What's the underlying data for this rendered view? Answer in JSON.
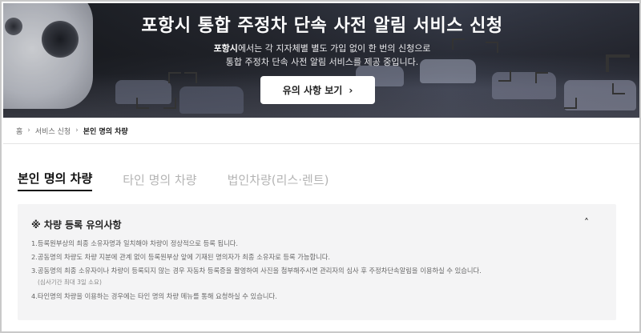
{
  "hero": {
    "title": "포항시 통합 주정차 단속 사전 알림 서비스 신청",
    "subtitle_bold": "포항시",
    "subtitle_line1_rest": "에서는 각 지자체별 별도 가입 없이 한 번의 신청으로",
    "subtitle_line2": "통합 주정차 단속 사전 알림 서비스를 제공 중입니다.",
    "button_label": "유의 사항 보기",
    "button_icon": "chevron-right-icon"
  },
  "breadcrumb": {
    "items": [
      "홈",
      "서비스 신청",
      "본인 명의 차량"
    ],
    "separator_icon": "chevron-right-icon"
  },
  "tabs": [
    {
      "label": "본인 명의 차량",
      "active": true
    },
    {
      "label": "타인 명의 차량",
      "active": false
    },
    {
      "label": "법인차량(리스·렌트)",
      "active": false
    }
  ],
  "notice": {
    "title": "※ 차량 등록 유의사항",
    "toggle_icon": "chevron-up-icon",
    "items": [
      {
        "text": "1.등록원부상의 최종 소유자명과 일치해야 차량이 정상적으로 등록 됩니다."
      },
      {
        "text": "2.공동명의 차량도 차량 지분에 관계 없이 등록원부상 앞에 기재된 명의자가 최종 소유자로 등록 가능합니다."
      },
      {
        "text": "3.공동명의 최종 소유자이나 차량이 등록되지 않는 경우 자동차 등록증을 촬영하여 사진을 첨부해주시면 관리자의 심사 후 주정차단속알림을 이용하실 수 있습니다.",
        "sub": "(심사기간 최대 3일 소요)"
      },
      {
        "text": "4.타인명의 차량을 이용하는 경우에는 타인 명의 차량 메뉴를 통해 요청하실 수 있습니다."
      }
    ]
  },
  "colors": {
    "accent_red": "#e23b3b",
    "accent_green": "#36c043",
    "tab_active": "#111111",
    "tab_inactive": "#b4b4b4",
    "notice_bg": "#f4f4f5"
  }
}
